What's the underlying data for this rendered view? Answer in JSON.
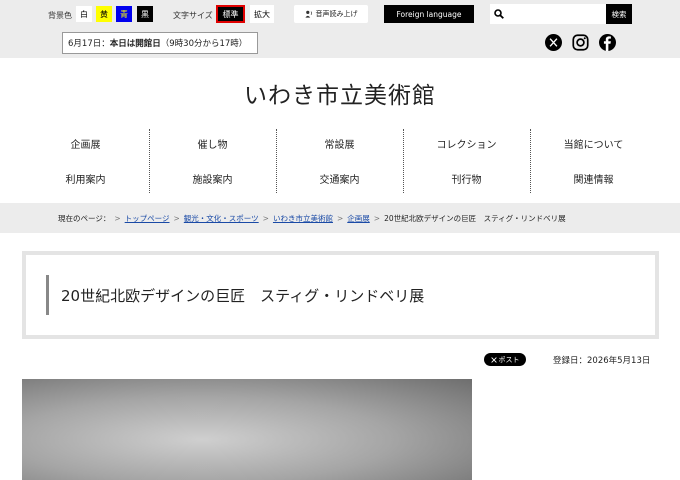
{
  "utility": {
    "bg_color_label": "背景色",
    "bg_colors": [
      {
        "label": "白",
        "color": "#ffffff"
      },
      {
        "label": "黄",
        "color": "#ffff00"
      },
      {
        "label": "青",
        "color": "#0000ee"
      },
      {
        "label": "黒",
        "color": "#000000"
      }
    ],
    "font_size_label": "文字サイズ",
    "font_standard": "標準",
    "font_large": "拡大",
    "voice_label": "音声読み上げ",
    "foreign_label": "Foreign language",
    "search_placeholder": "",
    "search_button": "検索"
  },
  "notice": {
    "date": "6月17日：",
    "status": "本日は開館日",
    "hours": "（9時30分から17時）"
  },
  "social": {
    "x_icon": "x-icon",
    "instagram_icon": "instagram-icon",
    "facebook_icon": "facebook-icon"
  },
  "site": {
    "title": "いわき市立美術館"
  },
  "nav": {
    "row1": [
      "企画展",
      "催し物",
      "常設展",
      "コレクション",
      "当館について"
    ],
    "row2": [
      "利用案内",
      "施設案内",
      "交通案内",
      "刊行物",
      "関連情報"
    ]
  },
  "breadcrumb": {
    "prefix": "現在のページ：",
    "items": [
      "トップページ",
      "観光・文化・スポーツ",
      "いわき市立美術館",
      "企画展"
    ],
    "current": "20世紀北欧デザインの巨匠　スティグ・リンドベリ展"
  },
  "page": {
    "title": "20世紀北欧デザインの巨匠　スティグ・リンドベリ展",
    "post_label": "ポスト",
    "registered_date": "登録日：2026年5月13日"
  },
  "colors": {
    "utility_bg": "#ececec",
    "link": "#1a4aa6",
    "active_border": "#e00000"
  }
}
